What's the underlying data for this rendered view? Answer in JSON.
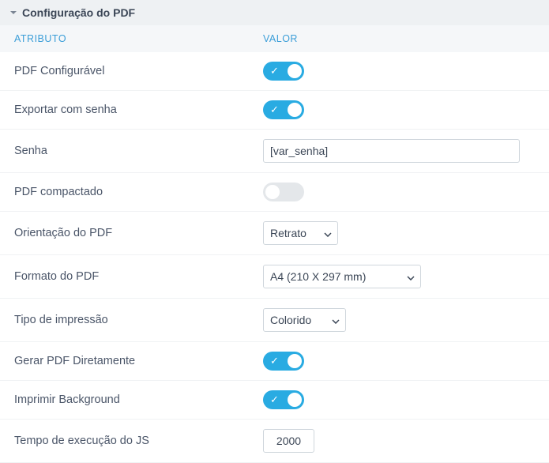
{
  "panel": {
    "title": "Configuração do PDF",
    "col_attr": "ATRIBUTO",
    "col_val": "VALOR"
  },
  "rows": {
    "pdf_configuravel": {
      "label": "PDF Configurável",
      "on": true
    },
    "exportar_senha": {
      "label": "Exportar com senha",
      "on": true
    },
    "senha": {
      "label": "Senha",
      "value": "[var_senha]"
    },
    "compactado": {
      "label": "PDF compactado",
      "on": false
    },
    "orientacao": {
      "label": "Orientação do PDF",
      "value": "Retrato"
    },
    "formato": {
      "label": "Formato do PDF",
      "value": "A4 (210 X 297 mm)"
    },
    "tipo_impressao": {
      "label": "Tipo de impressão",
      "value": "Colorido"
    },
    "gerar_direto": {
      "label": "Gerar PDF Diretamente",
      "on": true
    },
    "imprimir_bg": {
      "label": "Imprimir Background",
      "on": true
    },
    "tempo_js": {
      "label": "Tempo de execução do JS",
      "value": "2000"
    }
  }
}
